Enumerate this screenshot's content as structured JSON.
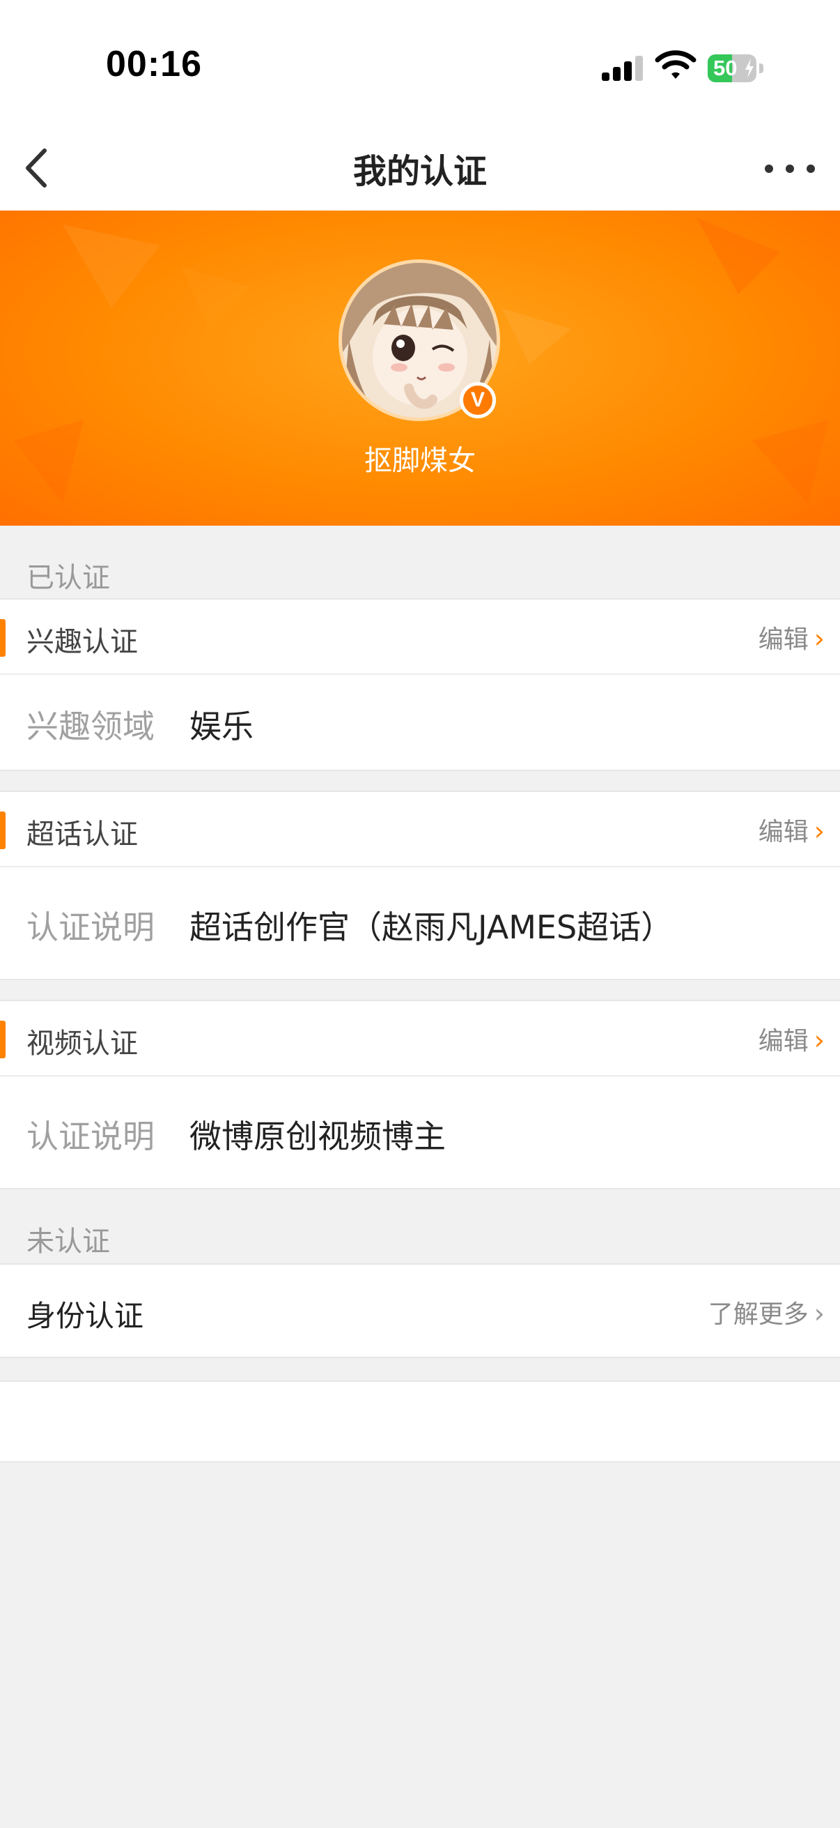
{
  "status_bar": {
    "time": "00:16",
    "battery_percent": "50",
    "battery_level": 0.5,
    "signal_icon": "cellular-signal-icon",
    "wifi_icon": "wifi-icon",
    "battery_icon": "battery-charging-icon"
  },
  "nav": {
    "title": "我的认证",
    "back_icon": "chevron-left-icon",
    "more_icon": "more-dots-icon"
  },
  "profile": {
    "username": "抠脚煤女",
    "verified_badge": "V",
    "accent_color": "#ff8200"
  },
  "sections": {
    "verified_label": "已认证",
    "unverified_label": "未认证"
  },
  "interest": {
    "title": "兴趣认证",
    "edit_label": "编辑",
    "field_label": "兴趣领域",
    "field_value": "娱乐"
  },
  "supertopic": {
    "title": "超话认证",
    "edit_label": "编辑",
    "field_label": "认证说明",
    "field_value": "超话创作官（赵雨凡JAMES超话）"
  },
  "video": {
    "title": "视频认证",
    "edit_label": "编辑",
    "field_label": "认证说明",
    "field_value": "微博原创视频博主"
  },
  "identity": {
    "title": "身份认证",
    "more_label": "了解更多"
  }
}
